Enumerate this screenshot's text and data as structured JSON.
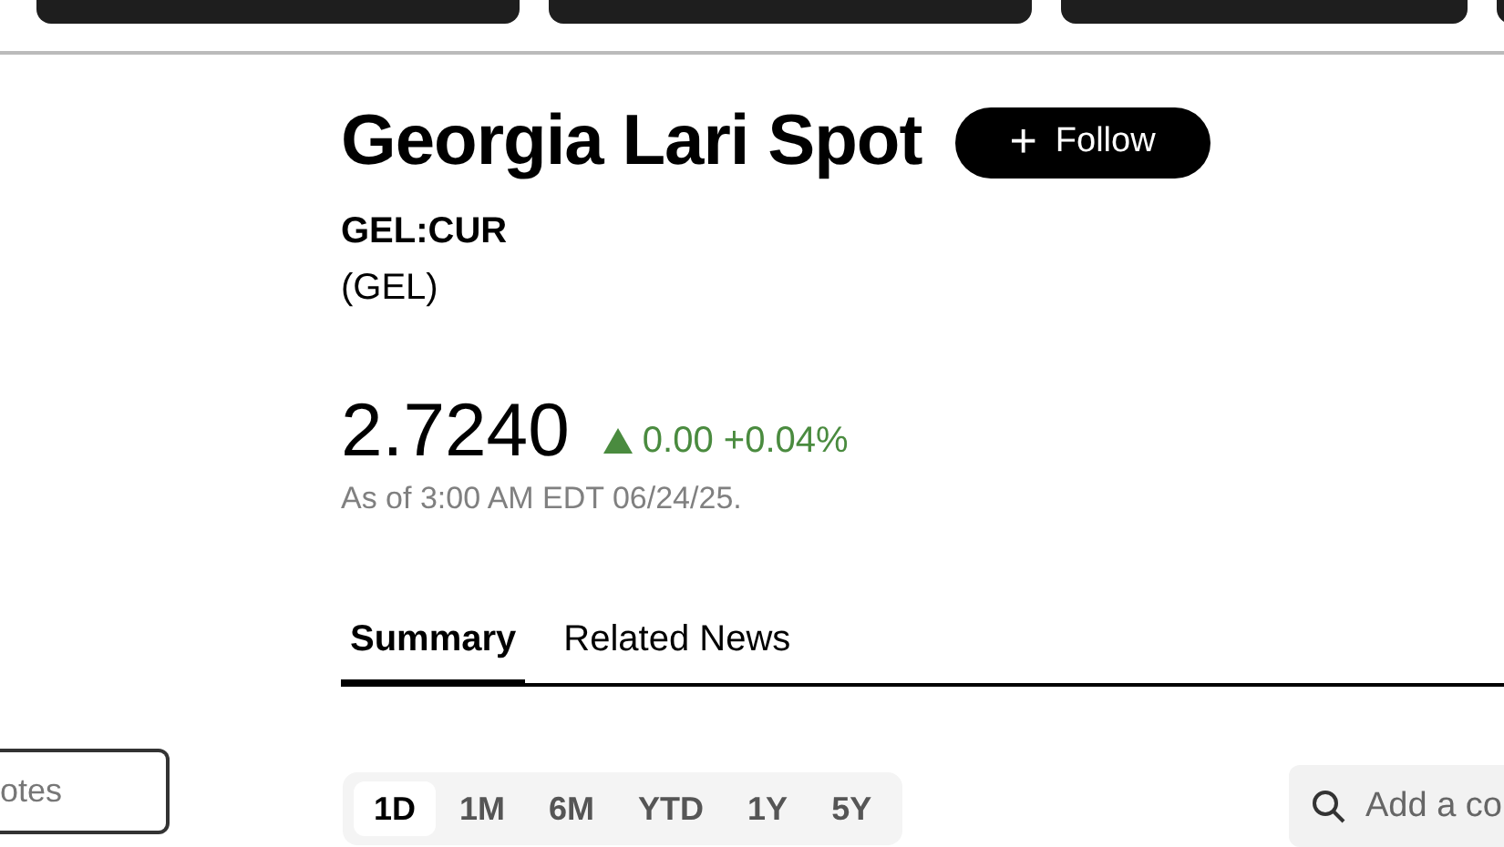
{
  "top_cards": [
    {
      "kind": "card"
    },
    {
      "kind": "card"
    },
    {
      "kind": "card"
    },
    {
      "kind": "card"
    }
  ],
  "title": "Georgia Lari Spot",
  "follow_button": {
    "icon": "+",
    "label": "Follow"
  },
  "ticker": "GEL:CUR",
  "code": "(GEL)",
  "price": "2.7240",
  "change": {
    "up": true,
    "value": "0.00",
    "percent": "+0.04%"
  },
  "as_of": "As of 3:00 AM EDT 06/24/25.",
  "tabs": [
    {
      "label": "Summary",
      "selected": true
    },
    {
      "label": "Related News",
      "selected": false
    }
  ],
  "notes_field": {
    "placeholder": "otes"
  },
  "ranges": [
    {
      "label": "1D",
      "selected": true
    },
    {
      "label": "1M",
      "selected": false
    },
    {
      "label": "6M",
      "selected": false
    },
    {
      "label": "YTD",
      "selected": false
    },
    {
      "label": "1Y",
      "selected": false
    },
    {
      "label": "5Y",
      "selected": false
    }
  ],
  "compare_search": {
    "placeholder": "Add a co"
  }
}
